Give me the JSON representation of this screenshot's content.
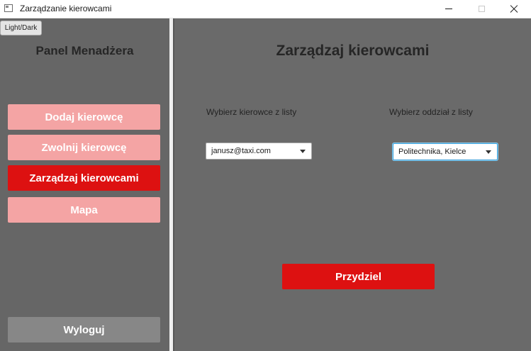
{
  "window": {
    "title": "Zarządzanie kierowcami"
  },
  "sidebar": {
    "theme_toggle_label": "Light/Dark",
    "panel_title": "Panel Menadżera",
    "items": [
      {
        "label": "Dodaj kierowcę",
        "active": false
      },
      {
        "label": "Zwolnij kierowcę",
        "active": false
      },
      {
        "label": "Zarządzaj kierowcami",
        "active": true
      },
      {
        "label": "Mapa",
        "active": false
      }
    ],
    "logout_label": "Wyloguj"
  },
  "main": {
    "title": "Zarządzaj kierowcami",
    "driver_select": {
      "label": "Wybierz kierowce z listy",
      "value": "janusz@taxi.com"
    },
    "branch_select": {
      "label": "Wybierz oddział z listy",
      "value": "Politechnika, Kielce"
    },
    "assign_label": "Przydziel"
  },
  "colors": {
    "accent_active": "#dd1111",
    "accent_light": "#f4a4a4",
    "background": "#6a6a6a",
    "logout": "#878787"
  }
}
